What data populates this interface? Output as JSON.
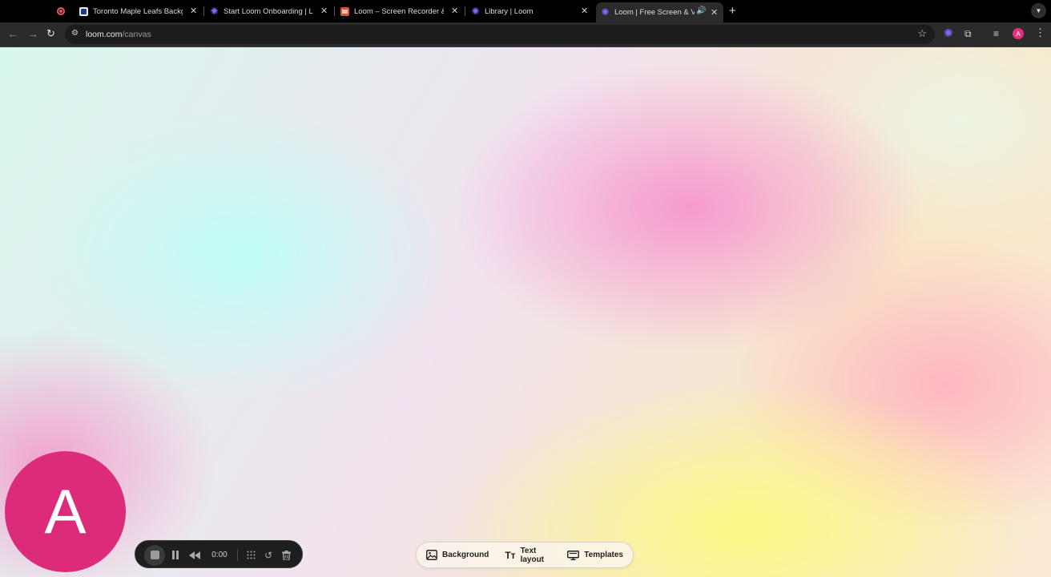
{
  "browser": {
    "tabs": [
      {
        "title": "Toronto Maple Leafs Backgro",
        "favicon": "leafs-favicon",
        "active": false
      },
      {
        "title": "Start Loom Onboarding | Loo",
        "favicon": "loom-favicon",
        "active": false
      },
      {
        "title": "Loom – Screen Recorder & S",
        "favicon": "store-favicon",
        "active": false
      },
      {
        "title": "Library | Loom",
        "favicon": "loom-favicon",
        "active": false
      },
      {
        "title": "Loom | Free Screen & Vide",
        "favicon": "loom-favicon",
        "active": true
      }
    ],
    "close_glyph": "✕",
    "new_tab_glyph": "+",
    "url_host": "loom.com",
    "url_path": "/canvas",
    "profile_initial": "A"
  },
  "camera": {
    "initial": "A",
    "color": "#dc2b7a"
  },
  "recording": {
    "timer": "0:00"
  },
  "canvas_toolbar": {
    "background_label": "Background",
    "text_layout_label": "Text layout",
    "templates_label": "Templates"
  }
}
